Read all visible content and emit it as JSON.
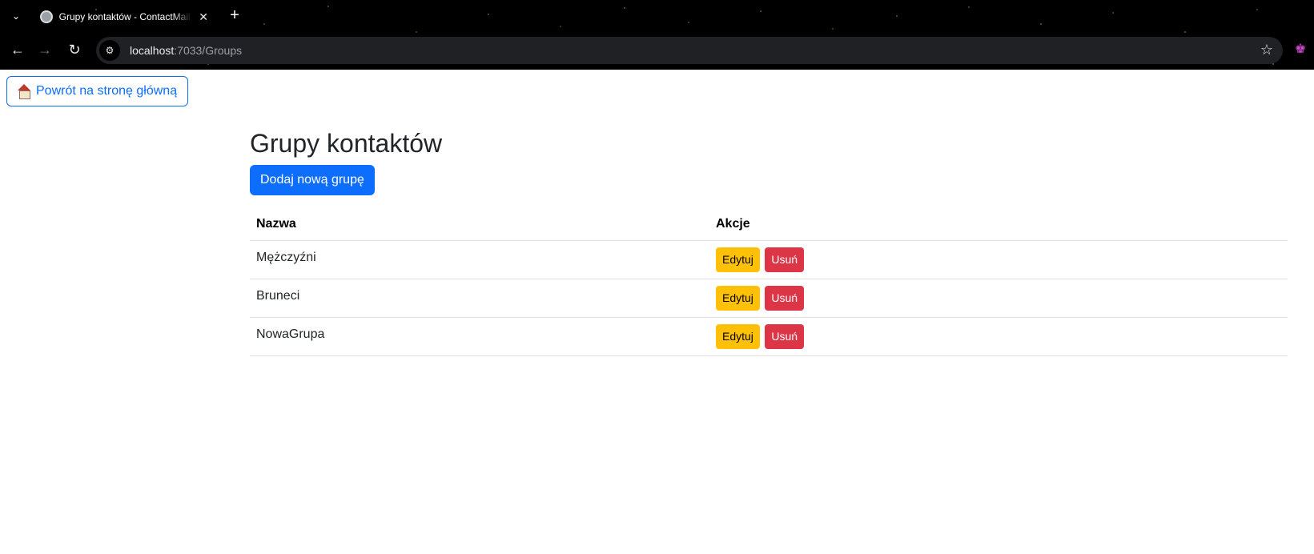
{
  "browser": {
    "tab_title": "Grupy kontaktów - ContactMail",
    "tab_close": "✕",
    "new_tab": "+",
    "url_host": "localhost",
    "url_rest": ":7033/Groups"
  },
  "icons": {
    "tab_list": "chevron-down-icon",
    "back": "arrow-left-icon",
    "forward": "arrow-right-icon",
    "reload": "reload-icon",
    "site_info": "tune-icon",
    "bookmark": "star-icon",
    "extension": "extension-icon",
    "home": "house-icon"
  },
  "page": {
    "back_home_label": "Powrót na stronę główną",
    "title": "Grupy kontaktów",
    "add_group_label": "Dodaj nową grupę",
    "table": {
      "headers": [
        "Nazwa",
        "Akcje"
      ],
      "rows": [
        {
          "name": "Mężczyźni",
          "edit": "Edytuj",
          "delete": "Usuń"
        },
        {
          "name": "Bruneci",
          "edit": "Edytuj",
          "delete": "Usuń"
        },
        {
          "name": "NowaGrupa",
          "edit": "Edytuj",
          "delete": "Usuń"
        }
      ]
    }
  },
  "colors": {
    "primary": "#0d6efd",
    "warning": "#ffc107",
    "danger": "#dc3545"
  }
}
